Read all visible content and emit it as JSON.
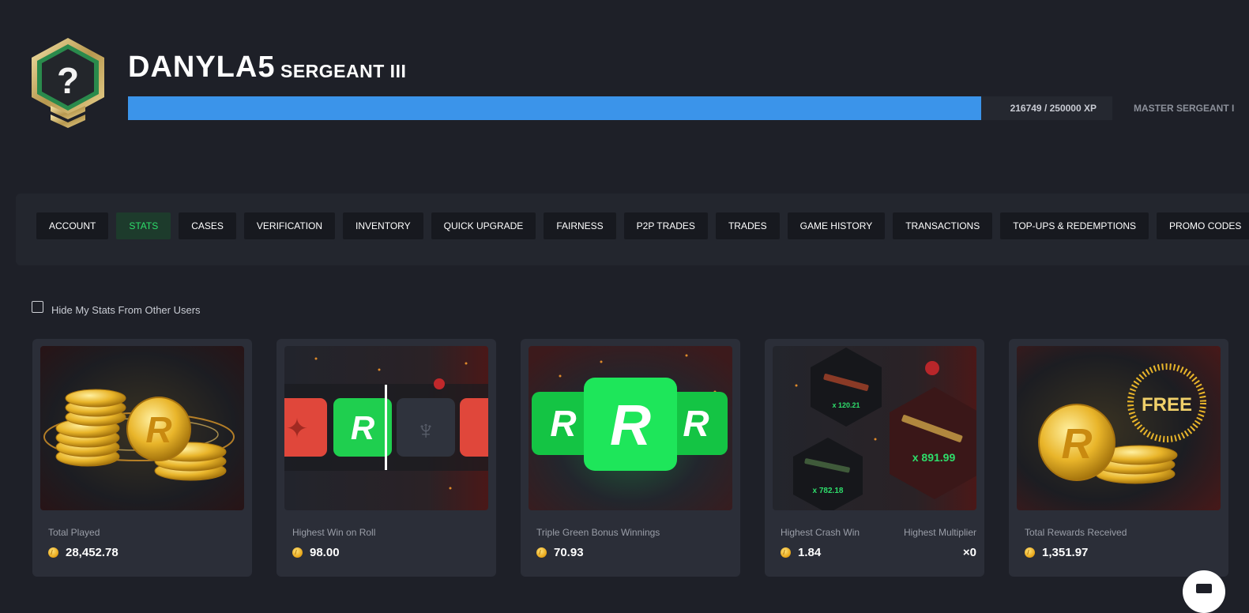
{
  "profile": {
    "username": "DANYLA5",
    "rank": "SERGEANT III",
    "xp_text": "216749 / 250000 XP",
    "xp_progress": 0.867,
    "next_rank": "MASTER SERGEANT I"
  },
  "tabs": [
    {
      "label": "ACCOUNT",
      "active": false
    },
    {
      "label": "STATS",
      "active": true
    },
    {
      "label": "CASES",
      "active": false
    },
    {
      "label": "VERIFICATION",
      "active": false
    },
    {
      "label": "INVENTORY",
      "active": false
    },
    {
      "label": "QUICK UPGRADE",
      "active": false
    },
    {
      "label": "FAIRNESS",
      "active": false
    },
    {
      "label": "P2P TRADES",
      "active": false
    },
    {
      "label": "TRADES",
      "active": false
    },
    {
      "label": "GAME HISTORY",
      "active": false
    },
    {
      "label": "TRANSACTIONS",
      "active": false
    },
    {
      "label": "TOP-UPS & REDEMPTIONS",
      "active": false
    },
    {
      "label": "PROMO CODES",
      "active": false
    }
  ],
  "hide_stats": {
    "label": "Hide My Stats From Other Users",
    "checked": false
  },
  "cards": [
    {
      "label": "Total Played",
      "value": "28,452.78",
      "image": "coins-pile"
    },
    {
      "label": "Highest Win on Roll",
      "value": "98.00",
      "image": "roll-strip"
    },
    {
      "label": "Triple Green Bonus Winnings",
      "value": "70.93",
      "image": "triple-green"
    },
    {
      "label": "Highest Crash Win",
      "value": "1.84",
      "label2": "Highest Multiplier",
      "value2": "×0",
      "image": "crash-weapons",
      "multipliers": [
        "x 120.21",
        "x 891.99",
        "x 782.18"
      ]
    },
    {
      "label": "Total Rewards Received",
      "value": "1,351.97",
      "image": "free-coins",
      "image_text": "FREE"
    }
  ],
  "colors": {
    "background": "#1e2028",
    "accent_green": "#2ede6b",
    "xp_blue": "#3b94ea",
    "roulette_red": "#e0473b",
    "coin_gold": "#e9a81b"
  }
}
